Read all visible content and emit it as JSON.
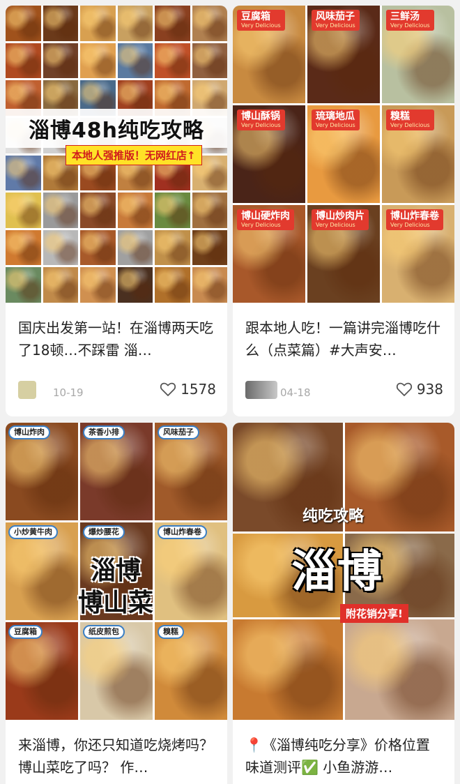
{
  "feed": {
    "cards": [
      {
        "cover": {
          "title": "淄博48h纯吃攻略",
          "subtitle": "本地人强推版！无网红店↑"
        },
        "title": "国庆出发第一站！在淄博两天吃了18顿…不踩雷 淄…",
        "date": "10-19",
        "likes": "1578"
      },
      {
        "cover": {
          "dishes": [
            "豆腐箱",
            "风味茄子",
            "三鲜汤",
            "博山酥锅",
            "琉璃地瓜",
            "糗糕",
            "博山硬炸肉",
            "博山炒肉片",
            "博山炸春卷"
          ],
          "dish_subtitle": "Very Delicious"
        },
        "title": "跟本地人吃！一篇讲完淄博吃什么（点菜篇）#大声安…",
        "date": "04-18",
        "likes": "938"
      },
      {
        "cover": {
          "dishes": [
            "博山炸肉",
            "茶香小排",
            "风味茄子",
            "小炒黄牛肉",
            "爆炒腰花",
            "博山炸春卷",
            "豆腐箱",
            "纸皮煎包",
            "糗糕"
          ],
          "title_line1": "淄博",
          "title_line2": "博山菜"
        },
        "title": "来淄博，你还只知道吃烧烤吗？博山菜吃了吗？ 作…"
      },
      {
        "cover": {
          "small_text": "纯吃攻略",
          "big_text": "淄博",
          "tag": "附花销分享!"
        },
        "title_pin": "📍",
        "title": "《淄博纯吃分享》价格位置味道测评✅ 小鱼游游…"
      }
    ]
  },
  "colors": {
    "background": "#f1f1f1",
    "card": "#ffffff",
    "label_red": "#e23a2e",
    "date_gray": "#a8a8a8"
  },
  "icons": {
    "like": "heart-outline-icon"
  }
}
